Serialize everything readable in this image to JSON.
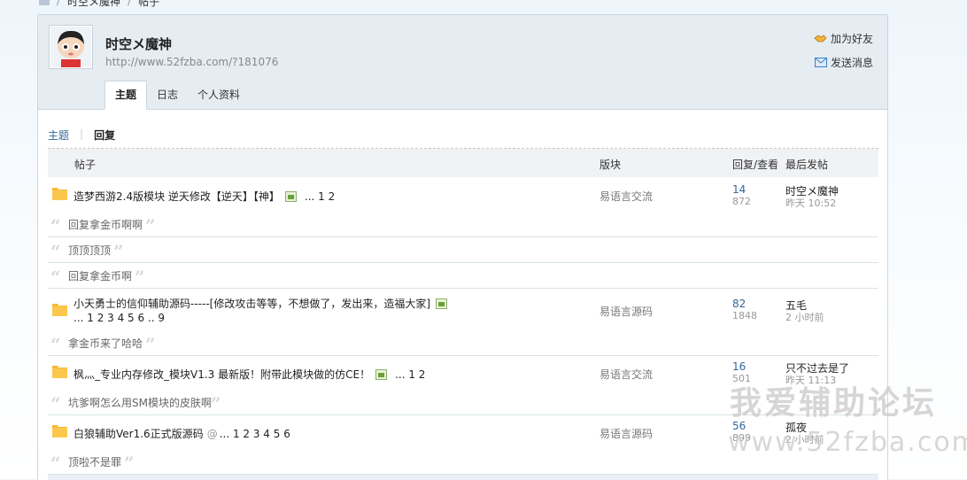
{
  "breadcrumb": {
    "items": [
      "时空メ魔神",
      "帖子"
    ]
  },
  "profile": {
    "name": "时空メ魔神",
    "url": "http://www.52fzba.com/?181076",
    "add_friend": "加为好友",
    "send_message": "发送消息"
  },
  "tabs": [
    {
      "label": "主题",
      "active": true
    },
    {
      "label": "日志",
      "active": false
    },
    {
      "label": "个人资料",
      "active": false
    }
  ],
  "subnav": {
    "topics": "主题",
    "replies": "回复"
  },
  "table": {
    "headers": {
      "post": "帖子",
      "forum": "版块",
      "replies_views": "回复/查看",
      "last_post": "最后发帖"
    }
  },
  "threads": [
    {
      "title": "造梦西游2.4版模块 逆天修改【逆天】【神】",
      "pages": "... 1 2",
      "forum": "易语言交流",
      "replies": "14",
      "views": "872",
      "last_user": "时空メ魔神",
      "last_time": "昨天 10:52",
      "quotes": [
        "回复拿金币啊啊",
        "顶顶顶顶",
        "回复拿金币啊"
      ]
    },
    {
      "title": "小天勇士的信仰辅助源码-----[修改攻击等等，不想做了，发出来，造福大家]",
      "pages": "... 1 2 3 4 5 6 .. 9",
      "forum": "易语言源码",
      "replies": "82",
      "views": "1848",
      "last_user": "五毛",
      "last_time": "2 小时前",
      "quotes": [
        "拿金币来了哈哈"
      ]
    },
    {
      "title": "枫灬_专业内存修改_模块V1.3 最新版！附带此模块做的仿CE！",
      "pages": "... 1 2",
      "forum": "易语言交流",
      "replies": "16",
      "views": "501",
      "last_user": "只不过去是了",
      "last_time": "昨天 11:13",
      "quotes": [
        "坑爹啊怎么用SM模块的皮肤啊"
      ]
    },
    {
      "title": "白狼辅助Ver1.6正式版源码",
      "pages": "... 1 2 3 4 5 6",
      "forum": "易语言源码",
      "replies": "56",
      "views": "899",
      "last_user": "孤夜",
      "last_time": "2 小时前",
      "quotes": [
        "顶啦不是罪"
      ]
    }
  ],
  "watermark": {
    "line1": "我爱辅助论坛",
    "line2": "www.52fzba.com"
  },
  "colors": {
    "link": "#336699",
    "header_bg": "#e5edf2",
    "folder": "#f7b733"
  }
}
